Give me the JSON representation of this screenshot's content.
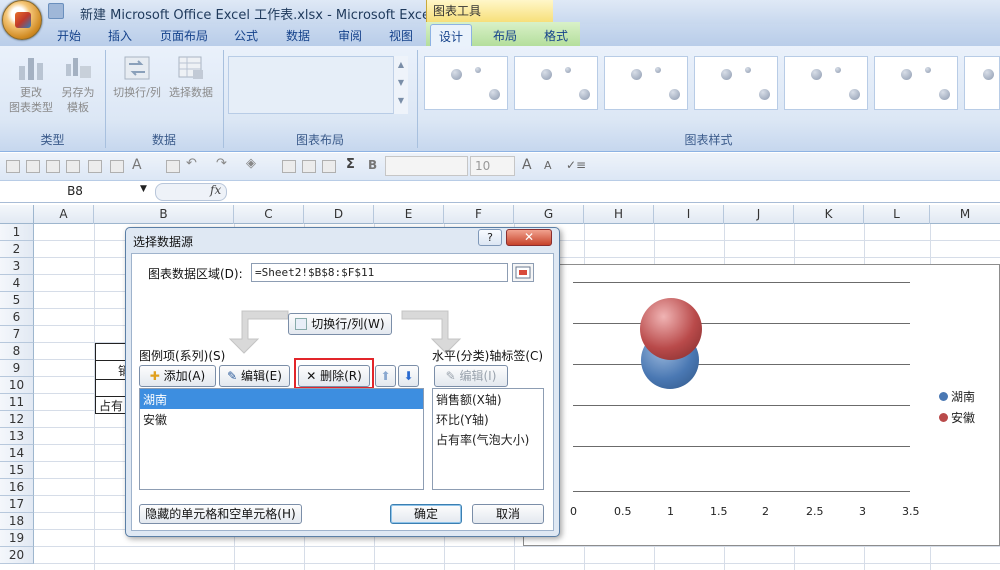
{
  "window": {
    "title": "新建 Microsoft Office Excel 工作表.xlsx - Microsoft Excel",
    "context_group": "图表工具"
  },
  "tabs": [
    "开始",
    "插入",
    "页面布局",
    "公式",
    "数据",
    "审阅",
    "视图",
    "设计",
    "布局",
    "格式"
  ],
  "active_tab": "设计",
  "ribbon": {
    "change_type_l1": "更改",
    "change_type_l2": "图表类型",
    "save_template_l1": "另存为",
    "save_template_l2": "模板",
    "switch_row_col": "切换行/列",
    "select_data": "选择数据",
    "group_type": "类型",
    "group_data": "数据",
    "group_layout": "图表布局",
    "group_style": "图表样式"
  },
  "toolbar": {
    "font_size": "10",
    "sigma": "Σ",
    "bold": "B",
    "font_grow": "A",
    "font_shrink": "A"
  },
  "formula_bar": {
    "cell_ref": "B8",
    "fx": "fx"
  },
  "columns": [
    "A",
    "B",
    "C",
    "D",
    "E",
    "F",
    "G",
    "H",
    "I",
    "J",
    "K",
    "L",
    "M"
  ],
  "rows": [
    "1",
    "2",
    "3",
    "4",
    "5",
    "6",
    "7",
    "8",
    "9",
    "10",
    "11",
    "12",
    "13",
    "14",
    "15",
    "16",
    "17",
    "18",
    "19",
    "20"
  ],
  "cells": {
    "b9_fragment": "销",
    "b11_fragment": "占有"
  },
  "chart_data": {
    "type": "bubble",
    "x_ticks": [
      "0",
      "0.5",
      "1",
      "1.5",
      "2",
      "2.5",
      "3",
      "3.5"
    ],
    "xlim": [
      0,
      3.5
    ],
    "grid": true,
    "legend_position": "right",
    "series": [
      {
        "name": "湖南",
        "color": "#4a78b3"
      },
      {
        "name": "安徽",
        "color": "#b94a4a"
      }
    ]
  },
  "dialog": {
    "title": "选择数据源",
    "help": "?",
    "close": "✕",
    "range_label": "图表数据区域(D):",
    "range_value": "=Sheet2!$B$8:$F$11",
    "switch_btn": "切换行/列(W)",
    "series_label": "图例项(系列)(S)",
    "add_btn": "添加(A)",
    "edit_btn": "编辑(E)",
    "delete_btn": "删除(R)",
    "series": [
      "湖南",
      "安徽"
    ],
    "selected_series": "湖南",
    "category_label": "水平(分类)轴标签(C)",
    "category_edit_btn": "编辑(I)",
    "categories": [
      "销售额(X轴)",
      "环比(Y轴)",
      "占有率(气泡大小)"
    ],
    "hidden_cells_btn": "隐藏的单元格和空单元格(H)",
    "ok_btn": "确定",
    "cancel_btn": "取消"
  }
}
